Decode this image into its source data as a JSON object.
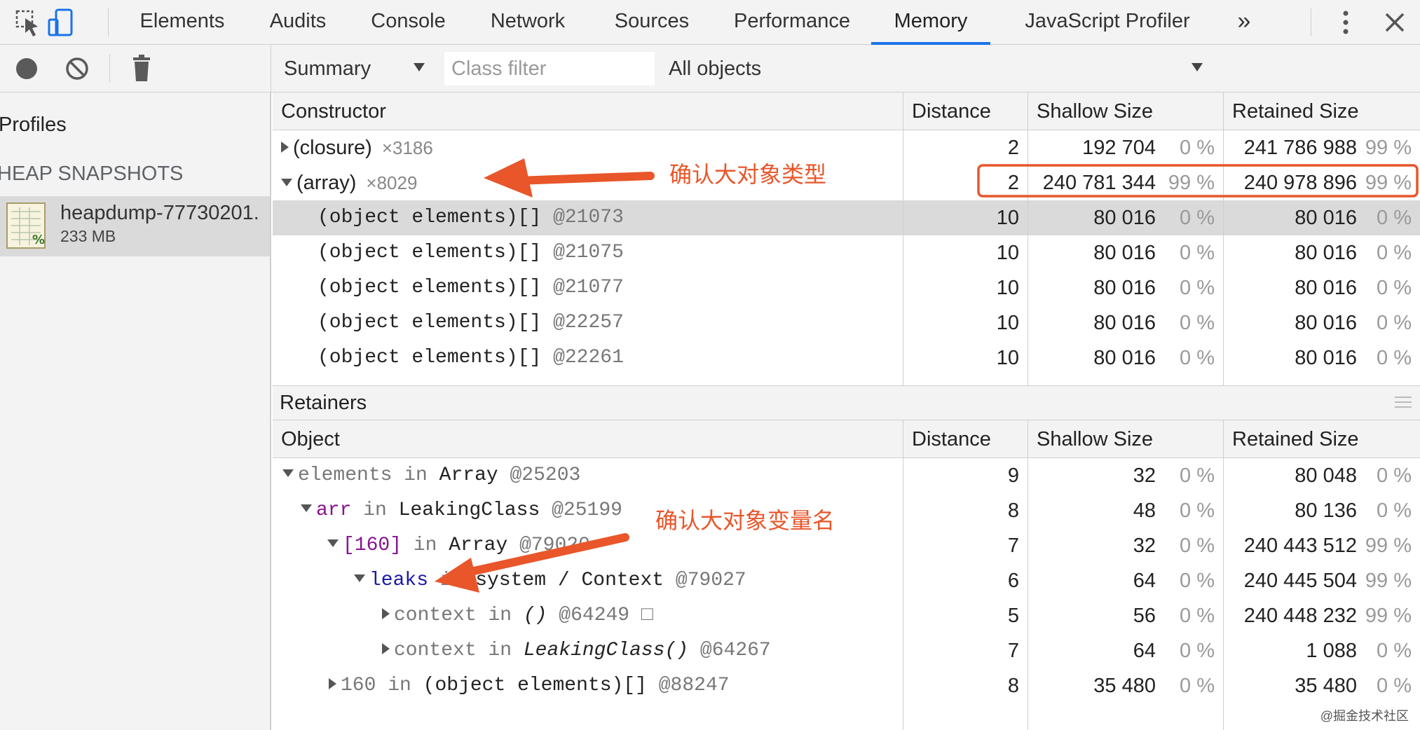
{
  "tabs": [
    {
      "label": "Elements",
      "active": false
    },
    {
      "label": "Audits",
      "active": false
    },
    {
      "label": "Console",
      "active": false
    },
    {
      "label": "Network",
      "active": false
    },
    {
      "label": "Sources",
      "active": false
    },
    {
      "label": "Performance",
      "active": false
    },
    {
      "label": "Memory",
      "active": true
    },
    {
      "label": "JavaScript Profiler",
      "active": false
    }
  ],
  "tabbar_icons": [
    "inspect-element-icon",
    "device-toolbar-icon",
    "more-tabs-icon",
    "kebab-menu-icon",
    "close-icon"
  ],
  "overflow_label": "»",
  "toolbar": {
    "view_label": "Summary",
    "class_filter_placeholder": "Class filter",
    "objects_label": "All objects",
    "icons": [
      "record-icon",
      "clear-icon",
      "garbage-collect-icon"
    ]
  },
  "sidebar": {
    "profiles_label": "Profiles",
    "section_label": "HEAP SNAPSHOTS",
    "snapshot": {
      "name": "heapdump-77730201.",
      "size": "233 MB"
    }
  },
  "constructor_grid": {
    "headers": {
      "name": "Constructor",
      "distance": "Distance",
      "shallow": "Shallow Size",
      "retained": "Retained Size"
    },
    "rows": [
      {
        "name": "(closure)",
        "count": "×3186",
        "distance": "2",
        "shallow": "192 704",
        "shallow_pct": "0 %",
        "retained": "241 786 988",
        "retained_pct": "99 %"
      },
      {
        "name": "(array)",
        "count": "×8029",
        "distance": "2",
        "shallow": "240 781 344",
        "shallow_pct": "99 %",
        "retained": "240 978 896",
        "retained_pct": "99 %"
      },
      {
        "name": "(object elements)[]",
        "id": "@21073",
        "distance": "10",
        "shallow": "80 016",
        "shallow_pct": "0 %",
        "retained": "80 016",
        "retained_pct": "0 %"
      },
      {
        "name": "(object elements)[]",
        "id": "@21075",
        "distance": "10",
        "shallow": "80 016",
        "shallow_pct": "0 %",
        "retained": "80 016",
        "retained_pct": "0 %"
      },
      {
        "name": "(object elements)[]",
        "id": "@21077",
        "distance": "10",
        "shallow": "80 016",
        "shallow_pct": "0 %",
        "retained": "80 016",
        "retained_pct": "0 %"
      },
      {
        "name": "(object elements)[]",
        "id": "@22257",
        "distance": "10",
        "shallow": "80 016",
        "shallow_pct": "0 %",
        "retained": "80 016",
        "retained_pct": "0 %"
      },
      {
        "name": "(object elements)[]",
        "id": "@22261",
        "distance": "10",
        "shallow": "80 016",
        "shallow_pct": "0 %",
        "retained": "80 016",
        "retained_pct": "0 %"
      }
    ]
  },
  "retainers": {
    "title": "Retainers",
    "headers": {
      "name": "Object",
      "distance": "Distance",
      "shallow": "Shallow Size",
      "retained": "Retained Size"
    },
    "rows": [
      {
        "prop": "elements",
        "kw": "in",
        "type": "Array",
        "id": "@25203",
        "distance": "9",
        "shallow": "32",
        "shallow_pct": "0 %",
        "retained": "80 048",
        "retained_pct": "0 %"
      },
      {
        "prop": "arr",
        "kw": "in",
        "type": "LeakingClass",
        "id": "@25199",
        "distance": "8",
        "shallow": "48",
        "shallow_pct": "0 %",
        "retained": "80 136",
        "retained_pct": "0 %"
      },
      {
        "prop": "[160]",
        "kw": "in",
        "type": "Array",
        "id": "@79020",
        "distance": "7",
        "shallow": "32",
        "shallow_pct": "0 %",
        "retained": "240 443 512",
        "retained_pct": "99 %"
      },
      {
        "prop": "leaks",
        "kw": "in",
        "type": "system / Context",
        "id": "@79027",
        "distance": "6",
        "shallow": "64",
        "shallow_pct": "0 %",
        "retained": "240 445 504",
        "retained_pct": "99 %"
      },
      {
        "prop": "context",
        "kw": "in",
        "type": "()",
        "id": "@64249 □",
        "distance": "5",
        "shallow": "56",
        "shallow_pct": "0 %",
        "retained": "240 448 232",
        "retained_pct": "99 %"
      },
      {
        "prop": "context",
        "kw": "in",
        "type": "LeakingClass()",
        "id": "@64267",
        "distance": "7",
        "shallow": "64",
        "shallow_pct": "0 %",
        "retained": "1 088",
        "retained_pct": "0 %"
      },
      {
        "prop": "160",
        "kw": "in",
        "type": "(object elements)[]",
        "id": "@88247",
        "distance": "8",
        "shallow": "35 480",
        "shallow_pct": "0 %",
        "retained": "35 480",
        "retained_pct": "0 %"
      }
    ]
  },
  "annotations": {
    "type_label": "确认大对象类型",
    "var_label": "确认大对象变量名",
    "color": "#e8562a"
  },
  "watermark": "@掘金技术社区",
  "colors": {
    "accent": "#1a73e8",
    "selected_row": "#dadada",
    "panel_bg": "#f3f3f3"
  }
}
